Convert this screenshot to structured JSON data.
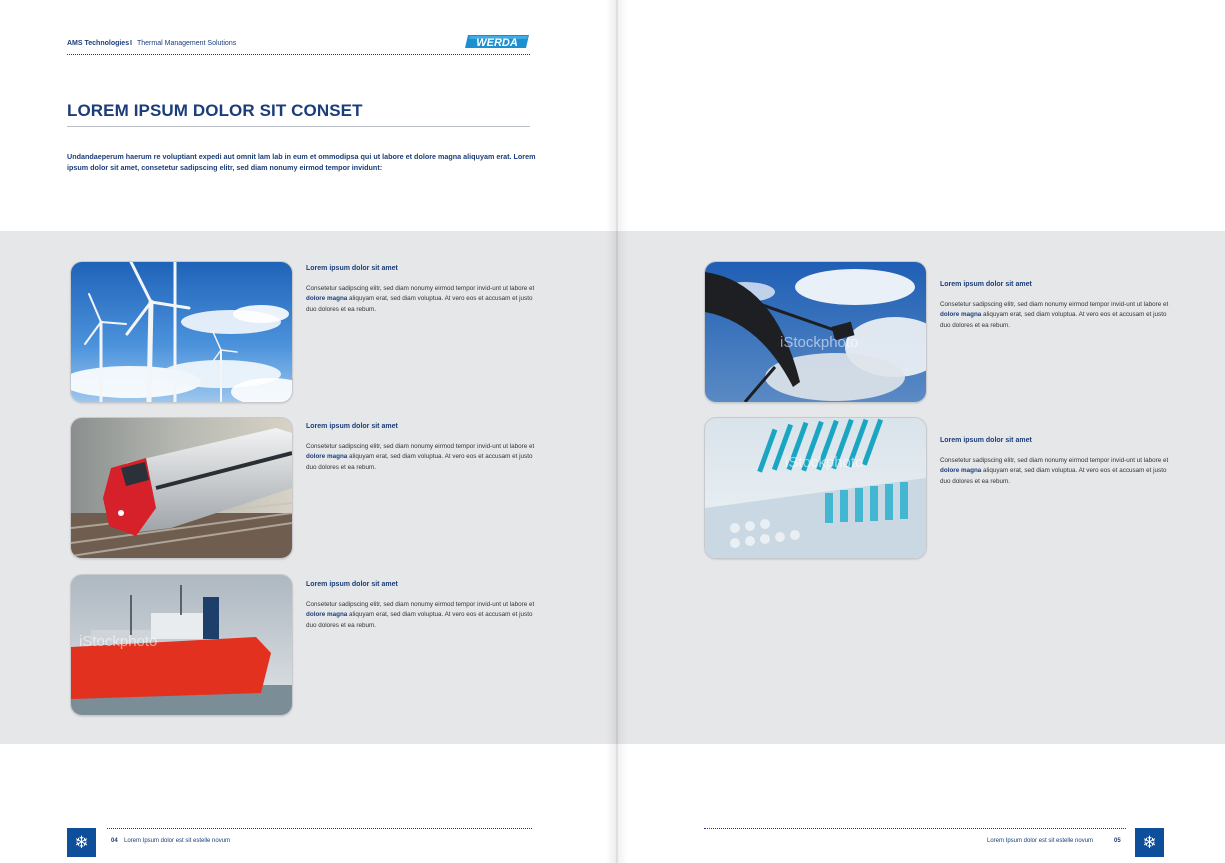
{
  "header": {
    "company": "AMS Technologies",
    "separator": "I",
    "tagline": "Thermal Management Solutions",
    "logo_text": "WERDA"
  },
  "left_page": {
    "title": "LOREM IPSUM DOLOR SIT CONSET",
    "intro": "Undandaeperum haerum re voluptiant expedi aut omnit lam lab in eum et ommodipsa qui ut labore et dolore magna aliquyam erat. Lorem ipsum dolor sit amet, consetetur sadipscing elitr, sed diam nonumy eirmod tempor invidunt:",
    "items": [
      {
        "image": "wind-turbines-photo",
        "title": "Lorem ipsum dolor sit amet",
        "body_pre": "Consetetur sadipscing elitr, sed diam nonumy eirmod tempor invid-unt ut labore et",
        "highlight": "dolore magna",
        "body_post": "aliquyam erat, sed diam voluptua. At vero eos et accusam et justo duo dolores et ea rebum."
      },
      {
        "image": "high-speed-train-photo",
        "title": "Lorem ipsum dolor sit amet",
        "body_pre": "Consetetur sadipscing elitr, sed diam nonumy eirmod tempor invid-unt ut labore et",
        "highlight": "dolore magna",
        "body_post": "aliquyam erat, sed diam voluptua. At vero eos et accusam et justo duo dolores et ea rebum."
      },
      {
        "image": "cargo-ship-photo",
        "watermark": "iStockphoto",
        "title": "Lorem ipsum dolor sit amet",
        "body_pre": "Consetetur sadipscing elitr, sed diam nonumy eirmod tempor invid-unt ut labore et",
        "highlight": "dolore magna",
        "body_post": "aliquyam erat, sed diam voluptua. At vero eos et accusam et justo duo dolores et ea rebum."
      }
    ],
    "footer": {
      "page_number": "04",
      "text": "Lorem Ipsum dolor est sit estelle novum",
      "icon": "snowflake-icon"
    }
  },
  "right_page": {
    "items": [
      {
        "image": "satellite-dish-photo",
        "watermark": "iStockphoto",
        "title": "Lorem ipsum dolor sit amet",
        "body_pre": "Consetetur sadipscing elitr, sed diam nonumy eirmod tempor invid-unt ut labore et",
        "highlight": "dolore magna",
        "body_post": "aliquyam erat, sed diam voluptua. At vero eos et accusam et justo duo dolores et ea rebum."
      },
      {
        "image": "lab-pipettes-photo",
        "watermark": "iStockphoto",
        "title": "Lorem ipsum dolor sit amet",
        "body_pre": "Consetetur sadipscing elitr, sed diam nonumy eirmod tempor invid-unt ut labore et",
        "highlight": "dolore magna",
        "body_post": "aliquyam erat, sed diam voluptua. At vero eos et accusam et justo duo dolores et ea rebum."
      }
    ],
    "footer": {
      "page_number": "05",
      "text": "Lorem Ipsum dolor est sit estelle novum",
      "icon": "snowflake-icon"
    }
  },
  "colors": {
    "brand_blue": "#1b3d7a",
    "band_grey": "#e6e7e9",
    "icon_blue": "#0e4f9b"
  }
}
